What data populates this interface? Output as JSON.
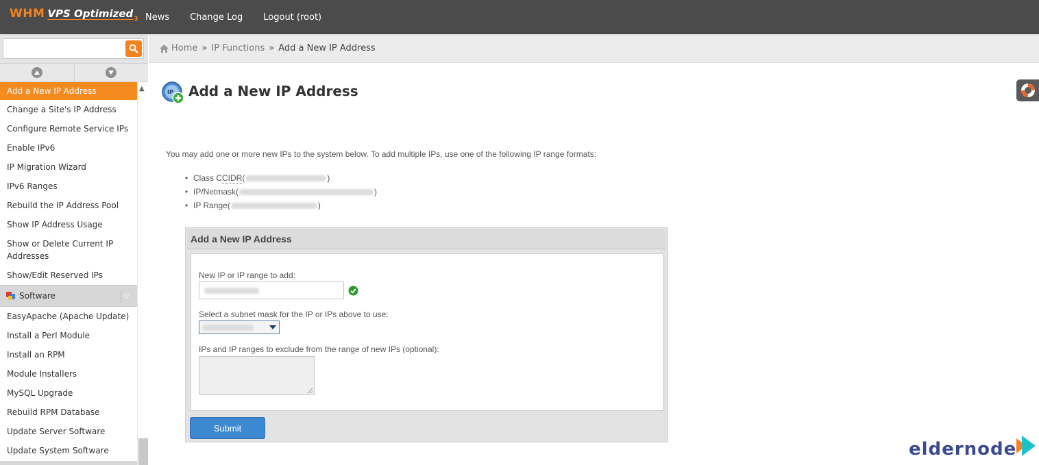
{
  "topbar": {
    "logo": {
      "brand": "WHM",
      "product": "VPS Optimized",
      "version": "3"
    },
    "nav": [
      {
        "label": "News"
      },
      {
        "label": "Change Log"
      },
      {
        "label": "Logout (root)"
      }
    ]
  },
  "sidebar": {
    "search": {
      "value": "",
      "placeholder": ""
    },
    "items": [
      {
        "label": "Add a New IP Address"
      },
      {
        "label": "Change a Site's IP Address"
      },
      {
        "label": "Configure Remote Service IPs"
      },
      {
        "label": "Enable IPv6"
      },
      {
        "label": "IP Migration Wizard"
      },
      {
        "label": "IPv6 Ranges"
      },
      {
        "label": "Rebuild the IP Address Pool"
      },
      {
        "label": "Show IP Address Usage"
      },
      {
        "label": "Show or Delete Current IP Addresses"
      },
      {
        "label": "Show/Edit Reserved IPs"
      }
    ],
    "section": {
      "label": "Software"
    },
    "software_items": [
      {
        "label": "EasyApache (Apache Update)"
      },
      {
        "label": "Install a Perl Module"
      },
      {
        "label": "Install an RPM"
      },
      {
        "label": "Module Installers"
      },
      {
        "label": "MySQL Upgrade"
      },
      {
        "label": "Rebuild RPM Database"
      },
      {
        "label": "Update Server Software"
      },
      {
        "label": "Update System Software"
      }
    ]
  },
  "breadcrumb": {
    "home": "Home",
    "sep": "»",
    "parent": "IP Functions",
    "current": "Add a New IP Address"
  },
  "main": {
    "title": "Add a New IP Address",
    "intro": "You may add one or more new IPs to the system below. To add multiple IPs, use one of the following IP range formats:",
    "formats": [
      {
        "prefix": "Class C ",
        "abbr": "CIDR",
        "open": " (",
        "close": ")"
      },
      {
        "prefix": "IP/Netmask",
        "abbr": "",
        "open": " (",
        "close": ")"
      },
      {
        "prefix": "IP Range",
        "abbr": "",
        "open": " (",
        "close": ")"
      }
    ],
    "form": {
      "header": "Add a New IP Address",
      "ip_label": "New IP or IP range to add:",
      "mask_label": "Select a subnet mask for the IP or IPs above to use:",
      "exclude_label": "IPs and IP ranges to exclude from the range of new IPs (optional):",
      "submit_label": "Submit"
    }
  },
  "watermark": {
    "text": "eldernode"
  },
  "colors": {
    "topbar": "#4b4b4b",
    "accent": "#f58220",
    "active_item": "#f58a1f",
    "submit": "#3d89d1",
    "ok_green": "#2e9a2e"
  }
}
